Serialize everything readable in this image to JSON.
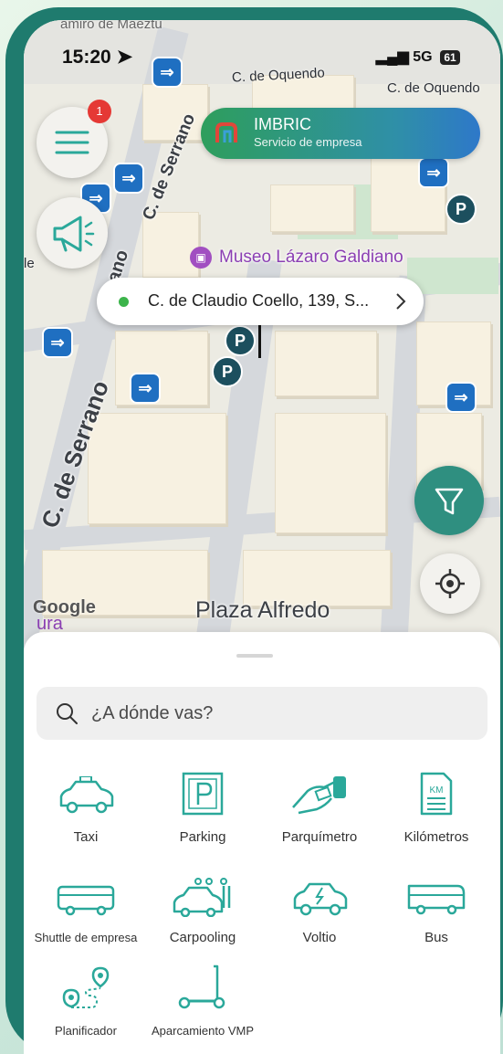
{
  "status": {
    "time": "15:20",
    "network": "5G",
    "battery": "61"
  },
  "map": {
    "street_top": "C. de Oquendo",
    "street_top2": "C. de Oquendo",
    "street_serrano": "C. de Serrano",
    "street_serrano2": "C. de Serrano",
    "street_ano": "ano",
    "poi": "Museo Lázaro Galdiano",
    "plaza": "Plaza Alfredo",
    "google": "Google",
    "top_partial": "amiro de Maeztu",
    "left_partial": "le",
    "bottom_partial": "ura"
  },
  "menu": {
    "badge": "1"
  },
  "company_pill": {
    "title": "IMBRIC",
    "subtitle": "Servicio de empresa"
  },
  "address_bar": {
    "text": "C. de Claudio Coello, 139, S..."
  },
  "search": {
    "placeholder": "¿A dónde vas?"
  },
  "services": [
    {
      "label": "Taxi",
      "icon": "taxi-icon"
    },
    {
      "label": "Parking",
      "icon": "parking-icon"
    },
    {
      "label": "Parquímetro",
      "icon": "parking-meter-icon"
    },
    {
      "label": "Kilómetros",
      "icon": "kilometers-icon"
    },
    {
      "label": "Shuttle de empresa",
      "icon": "shuttle-icon"
    },
    {
      "label": "Carpooling",
      "icon": "carpooling-icon"
    },
    {
      "label": "Voltio",
      "icon": "electric-car-icon"
    },
    {
      "label": "Bus",
      "icon": "bus-icon"
    },
    {
      "label": "Planificador",
      "icon": "route-planner-icon"
    },
    {
      "label": "Aparcamiento VMP",
      "icon": "scooter-icon"
    }
  ],
  "colors": {
    "teal": "#1f7b6e",
    "accent": "#2aa89a",
    "pill_start": "#2e9e5c",
    "pill_end": "#2e78c9"
  }
}
